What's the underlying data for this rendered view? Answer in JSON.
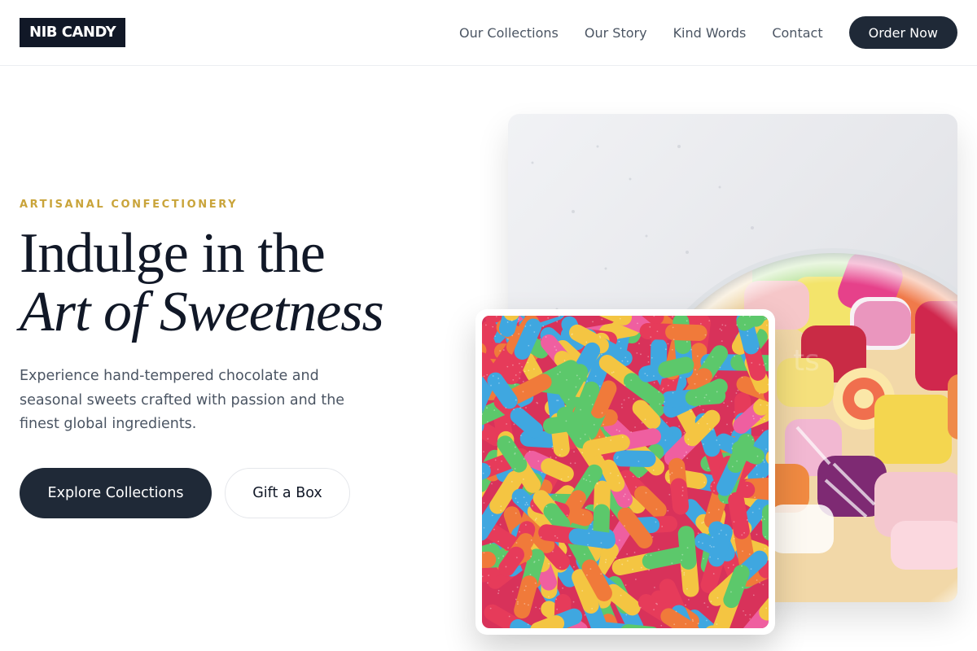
{
  "brand": {
    "logo_text": "NIB CANDY"
  },
  "nav": {
    "items": [
      {
        "label": "Our Collections"
      },
      {
        "label": "Our Story"
      },
      {
        "label": "Kind Words"
      },
      {
        "label": "Contact"
      }
    ],
    "cta_label": "Order Now"
  },
  "hero": {
    "eyebrow": "ARTISANAL CONFECTIONERY",
    "headline_line1": "Indulge in the",
    "headline_line2": "Art of Sweetness",
    "description": "Experience hand-tempered chocolate and seasonal sweets crafted with passion and the finest global ingredients.",
    "primary_button": "Explore Collections",
    "secondary_button": "Gift a Box"
  },
  "images": {
    "main": {
      "subject": "glass jar of assorted hard candies"
    },
    "inset": {
      "subject": "pile of sour gummy worms"
    }
  },
  "colors": {
    "accent": "#c9a43a",
    "dark": "#1f2937",
    "brand_bg": "#111827",
    "text_muted": "#4b5563"
  }
}
